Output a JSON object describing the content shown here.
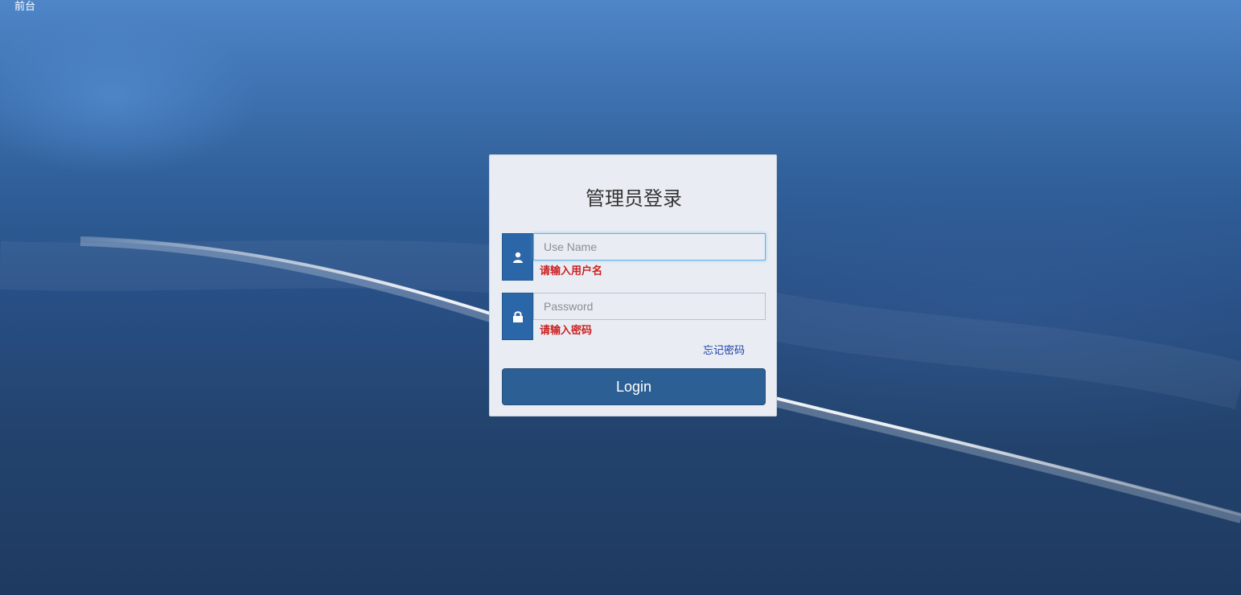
{
  "nav": {
    "front_label": "前台"
  },
  "login": {
    "title": "管理员登录",
    "username": {
      "value": "",
      "placeholder": "Use Name",
      "error": "请输入用户名",
      "icon": "user-icon"
    },
    "password": {
      "value": "",
      "placeholder": "Password",
      "error": "请输入密码",
      "icon": "lock-icon"
    },
    "forgot_label": "忘记密码",
    "submit_label": "Login"
  },
  "colors": {
    "accent": "#2c5f94",
    "error": "#cc1f1f",
    "link": "#1a3fa8"
  }
}
